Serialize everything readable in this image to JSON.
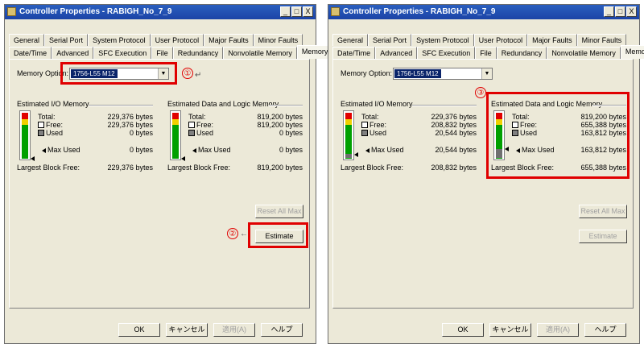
{
  "windows": [
    {
      "title": "Controller Properties - RABIGH_No_7_9",
      "title_buttons": [
        "_",
        "□",
        "X"
      ],
      "tabs_row1": [
        "General",
        "Serial Port",
        "System Protocol",
        "User Protocol",
        "Major Faults",
        "Minor Faults"
      ],
      "tabs_row2": [
        "Date/Time",
        "Advanced",
        "SFC Execution",
        "File",
        "Redundancy",
        "Nonvolatile Memory",
        "Memory"
      ],
      "active_tab": "Memory",
      "memory_option_label": "Memory Option:",
      "memory_option_value": "1756-L55 M12",
      "io_title": "Estimated I/O Memory",
      "io_total_label": "Total:",
      "io_total": "229,376 bytes",
      "io_free_label": "Free:",
      "io_free": "229,376 bytes",
      "io_used_label": "Used",
      "io_used": "0 bytes",
      "io_max_label": "Max Used",
      "io_max": "0 bytes",
      "io_largest_label": "Largest Block Free:",
      "io_largest": "229,376 bytes",
      "io_used_fraction": 0,
      "data_title": "Estimated Data and Logic Memory",
      "data_total_label": "Total:",
      "data_total": "819,200 bytes",
      "data_free_label": "Free:",
      "data_free": "819,200 bytes",
      "data_used_label": "Used",
      "data_used": "0 bytes",
      "data_max_label": "Max Used",
      "data_max": "0 bytes",
      "data_largest_label": "Largest Block Free:",
      "data_largest": "819,200 bytes",
      "data_used_fraction": 0,
      "reset_label": "Reset All Max",
      "estimate_label": "Estimate",
      "ok_label": "OK",
      "cancel_label": "キャンセル",
      "apply_label": "適用(A)",
      "help_label": "ヘルプ",
      "callouts": [
        "①",
        "②"
      ]
    },
    {
      "title": "Controller Properties - RABIGH_No_7_9",
      "title_buttons": [
        "_",
        "□",
        "X"
      ],
      "tabs_row1": [
        "General",
        "Serial Port",
        "System Protocol",
        "User Protocol",
        "Major Faults",
        "Minor Faults"
      ],
      "tabs_row2": [
        "Date/Time",
        "Advanced",
        "SFC Execution",
        "File",
        "Redundancy",
        "Nonvolatile Memory",
        "Memory"
      ],
      "active_tab": "Memory",
      "memory_option_label": "Memory Option:",
      "memory_option_value": "1756-L55 M12",
      "io_title": "Estimated I/O Memory",
      "io_total_label": "Total:",
      "io_total": "229,376 bytes",
      "io_free_label": "Free:",
      "io_free": "208,832 bytes",
      "io_used_label": "Used",
      "io_used": "20,544 bytes",
      "io_max_label": "Max Used",
      "io_max": "20,544 bytes",
      "io_largest_label": "Largest Block Free:",
      "io_largest": "208,832 bytes",
      "io_used_fraction": 0.09,
      "data_title": "Estimated Data and Logic Memory",
      "data_total_label": "Total:",
      "data_total": "819,200 bytes",
      "data_free_label": "Free:",
      "data_free": "655,388 bytes",
      "data_used_label": "Used",
      "data_used": "163,812 bytes",
      "data_max_label": "Max Used",
      "data_max": "163,812 bytes",
      "data_largest_label": "Largest Block Free:",
      "data_largest": "655,388 bytes",
      "data_used_fraction": 0.2,
      "reset_label": "Reset All Max",
      "estimate_label": "Estimate",
      "ok_label": "OK",
      "cancel_label": "キャンセル",
      "apply_label": "適用(A)",
      "help_label": "ヘルプ",
      "callouts": [
        "③"
      ]
    }
  ],
  "colors": {
    "highlight": "#e00000",
    "title_bar": "#1b43a6",
    "dialog_bg": "#ece9d8"
  }
}
